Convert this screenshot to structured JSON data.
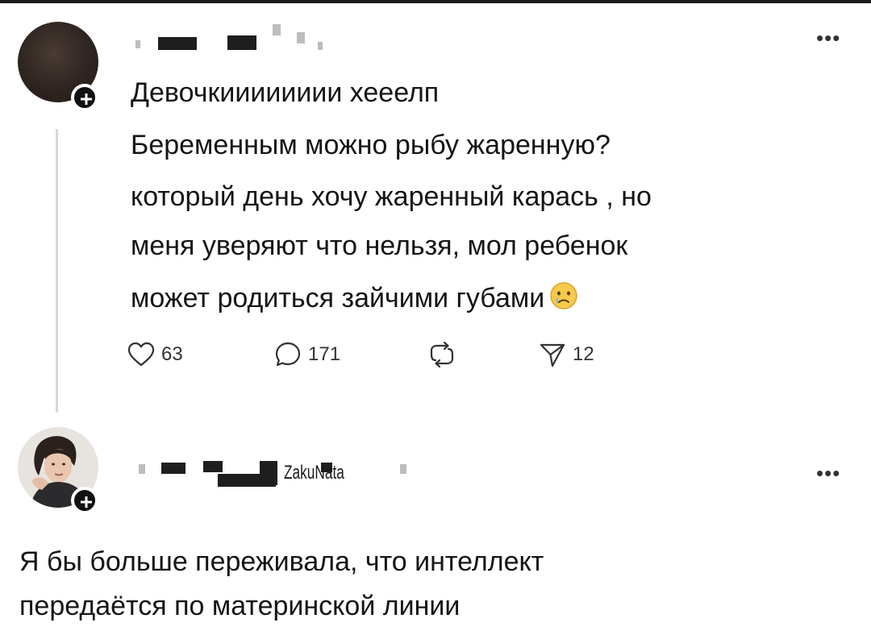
{
  "post": {
    "lines": [
      "Девочкииииииии хееелп",
      "Беременным можно рыбу жаренную?",
      "который день хочу жаренный карась , но",
      "меня уверяют что нельзя, мол ребенок",
      "может родиться зайчими губами"
    ],
    "emoji": "crying-face-emoji",
    "more_icon": "more-dots-icon",
    "actions": {
      "likes": "63",
      "comments": "171",
      "reposts": "",
      "shares": "12"
    }
  },
  "reply": {
    "username": "ZakuNata",
    "lines": [
      "Я бы больше переживала, что интеллект",
      "передаётся по материнской линии"
    ],
    "more_icon": "more-dots-icon"
  },
  "colors": {
    "text": "#151515",
    "badge": "#111111",
    "thread_line": "#d8d8d8"
  }
}
